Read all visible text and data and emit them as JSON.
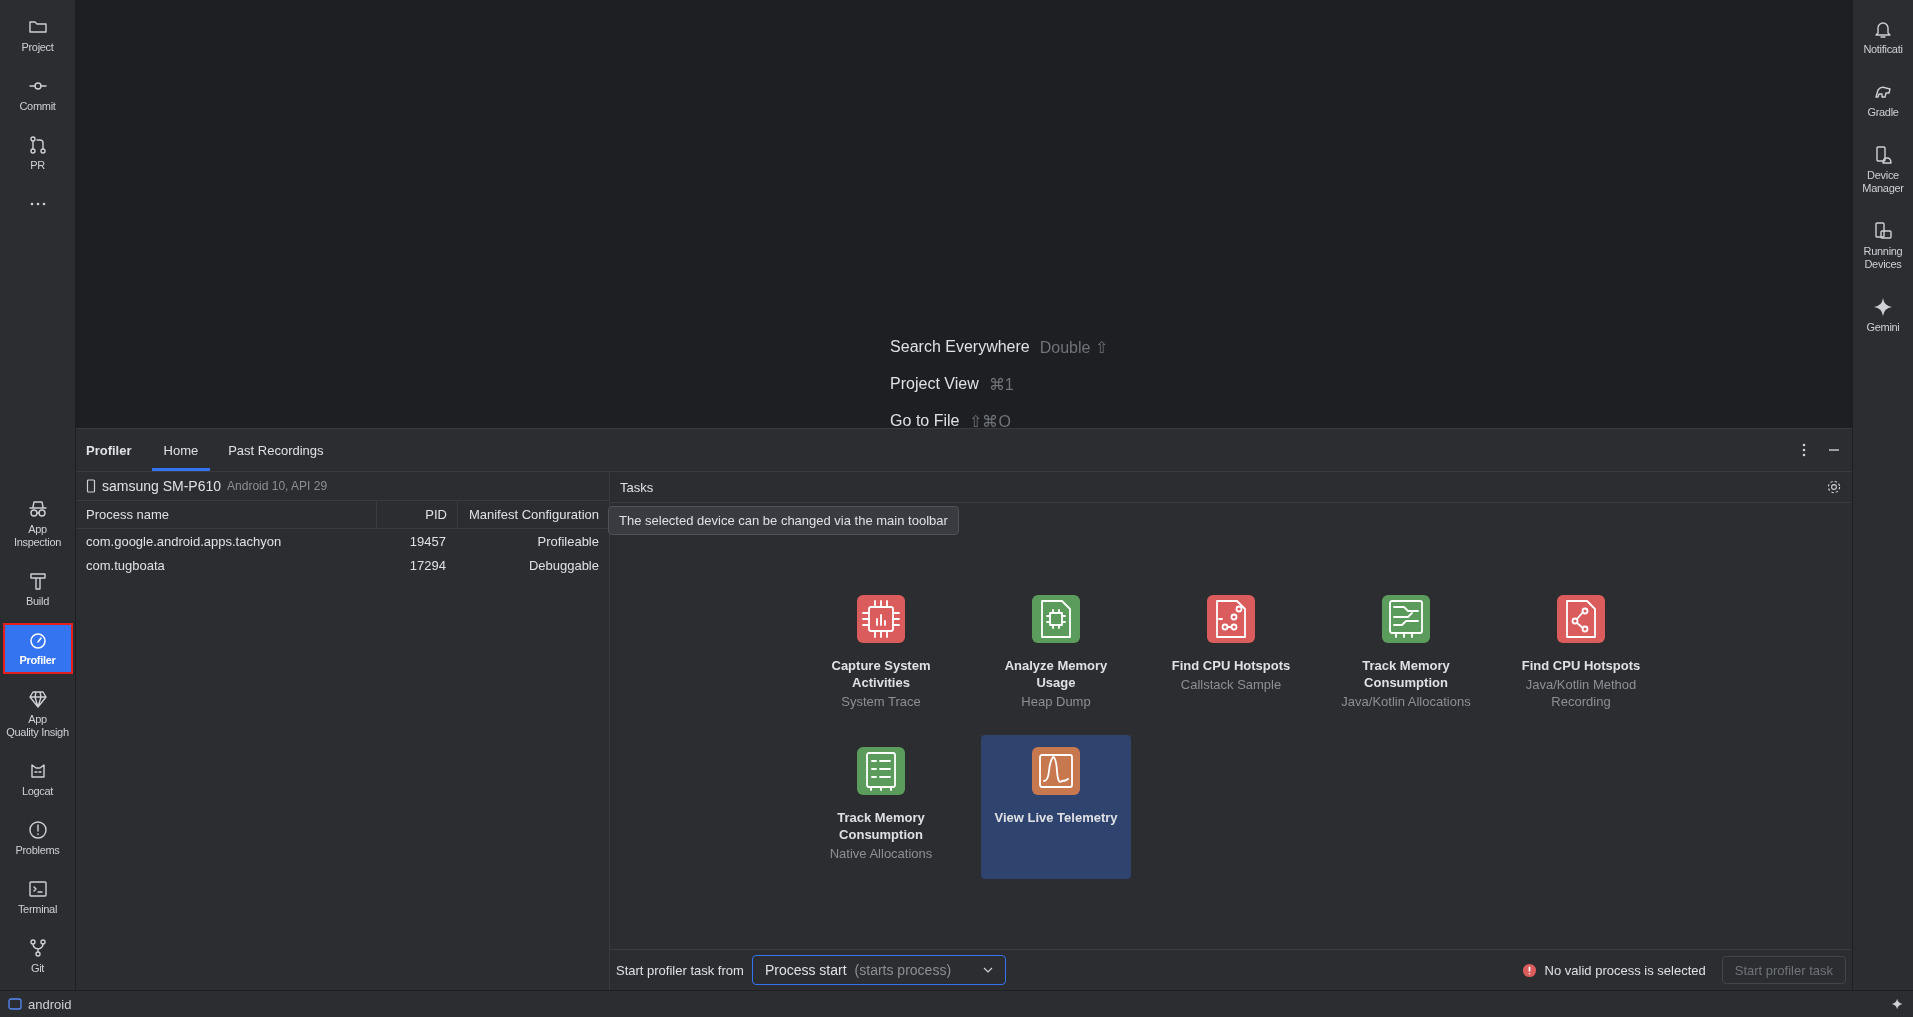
{
  "left_toolbar": {
    "top": [
      {
        "label": "Project",
        "kind": "folder",
        "selected": false,
        "annotated": false
      },
      {
        "label": "Commit",
        "kind": "commit",
        "selected": false,
        "annotated": false
      },
      {
        "label": "PR",
        "kind": "pr",
        "selected": false,
        "annotated": false
      },
      {
        "kind": "more",
        "selected": false,
        "annotated": false
      }
    ],
    "bottom": [
      {
        "label": "App\nInspection",
        "kind": "inspect",
        "selected": false,
        "annotated": false
      },
      {
        "label": "Build",
        "kind": "hammer",
        "selected": false,
        "annotated": false
      },
      {
        "label": "Profiler",
        "kind": "gauge",
        "selected": true,
        "annotated": true
      },
      {
        "label": "App\nQuality Insigh",
        "kind": "gem",
        "selected": false,
        "annotated": false
      },
      {
        "label": "Logcat",
        "kind": "cat",
        "selected": false,
        "annotated": false
      },
      {
        "label": "Problems",
        "kind": "alert",
        "selected": false,
        "annotated": false
      },
      {
        "label": "Terminal",
        "kind": "terminal",
        "selected": false,
        "annotated": false
      },
      {
        "label": "Git",
        "kind": "git",
        "selected": false,
        "annotated": false
      }
    ]
  },
  "right_toolbar": [
    {
      "label": "Notificati",
      "kind": "bell"
    },
    {
      "label": "Gradle",
      "kind": "elephant"
    },
    {
      "label": "Device\nManager",
      "kind": "device"
    },
    {
      "label": "Running\nDevices",
      "kind": "running"
    },
    {
      "label": "Gemini",
      "kind": "sparkle"
    }
  ],
  "editor_hints": [
    {
      "action": "Search Everywhere",
      "shortcut": "Double ⇧"
    },
    {
      "action": "Project View",
      "shortcut": "⌘1"
    },
    {
      "action": "Go to File",
      "shortcut": "⇧⌘O"
    }
  ],
  "profiler": {
    "title": "Profiler",
    "tabs": [
      {
        "label": "Home",
        "selected": true
      },
      {
        "label": "Past Recordings",
        "selected": false
      }
    ],
    "device": {
      "name": "samsung SM-P610",
      "detail": "Android 10, API 29"
    },
    "process_table": {
      "columns": [
        "Process name",
        "PID",
        "Manifest Configuration"
      ],
      "rows": [
        [
          "com.google.android.apps.tachyon",
          "19457",
          "Profileable"
        ],
        [
          "com.tugboata",
          "17294",
          "Debuggable"
        ]
      ]
    },
    "tasks_title": "Tasks",
    "tooltip": "The selected device can be changed via the main toolbar",
    "tasks": [
      {
        "title": "Capture System Activities",
        "subtitle": "System Trace",
        "kind": "chip",
        "color": "#db5c5c",
        "selected": false
      },
      {
        "title": "Analyze Memory Usage",
        "subtitle": "Heap Dump",
        "kind": "chip-doc",
        "color": "#5b9b5b",
        "selected": false
      },
      {
        "title": "Find CPU Hotspots",
        "subtitle": "Callstack Sample",
        "kind": "nodes",
        "color": "#db5c5c",
        "selected": false
      },
      {
        "title": "Track Memory Consumption",
        "subtitle": "Java/Kotlin Allocations",
        "kind": "board",
        "color": "#5b9b5b",
        "selected": false
      },
      {
        "title": "Find CPU Hotspots",
        "subtitle": "Java/Kotlin Method Recording",
        "kind": "flow",
        "color": "#db5c5c",
        "selected": false
      },
      {
        "title": "Track Memory Consumption",
        "subtitle": "Native Allocations",
        "kind": "list",
        "color": "#5b9b5b",
        "selected": false
      },
      {
        "title": "View Live Telemetry",
        "kind": "wave",
        "color": "#c7784f",
        "selected": true
      }
    ],
    "start_from_label": "Start profiler task from",
    "start_from": {
      "value": "Process start",
      "hint": "(starts process)"
    },
    "error": "No valid process is selected",
    "start_button": {
      "label": "Start profiler task",
      "disabled": true
    }
  },
  "status_bar": {
    "project": "android"
  }
}
